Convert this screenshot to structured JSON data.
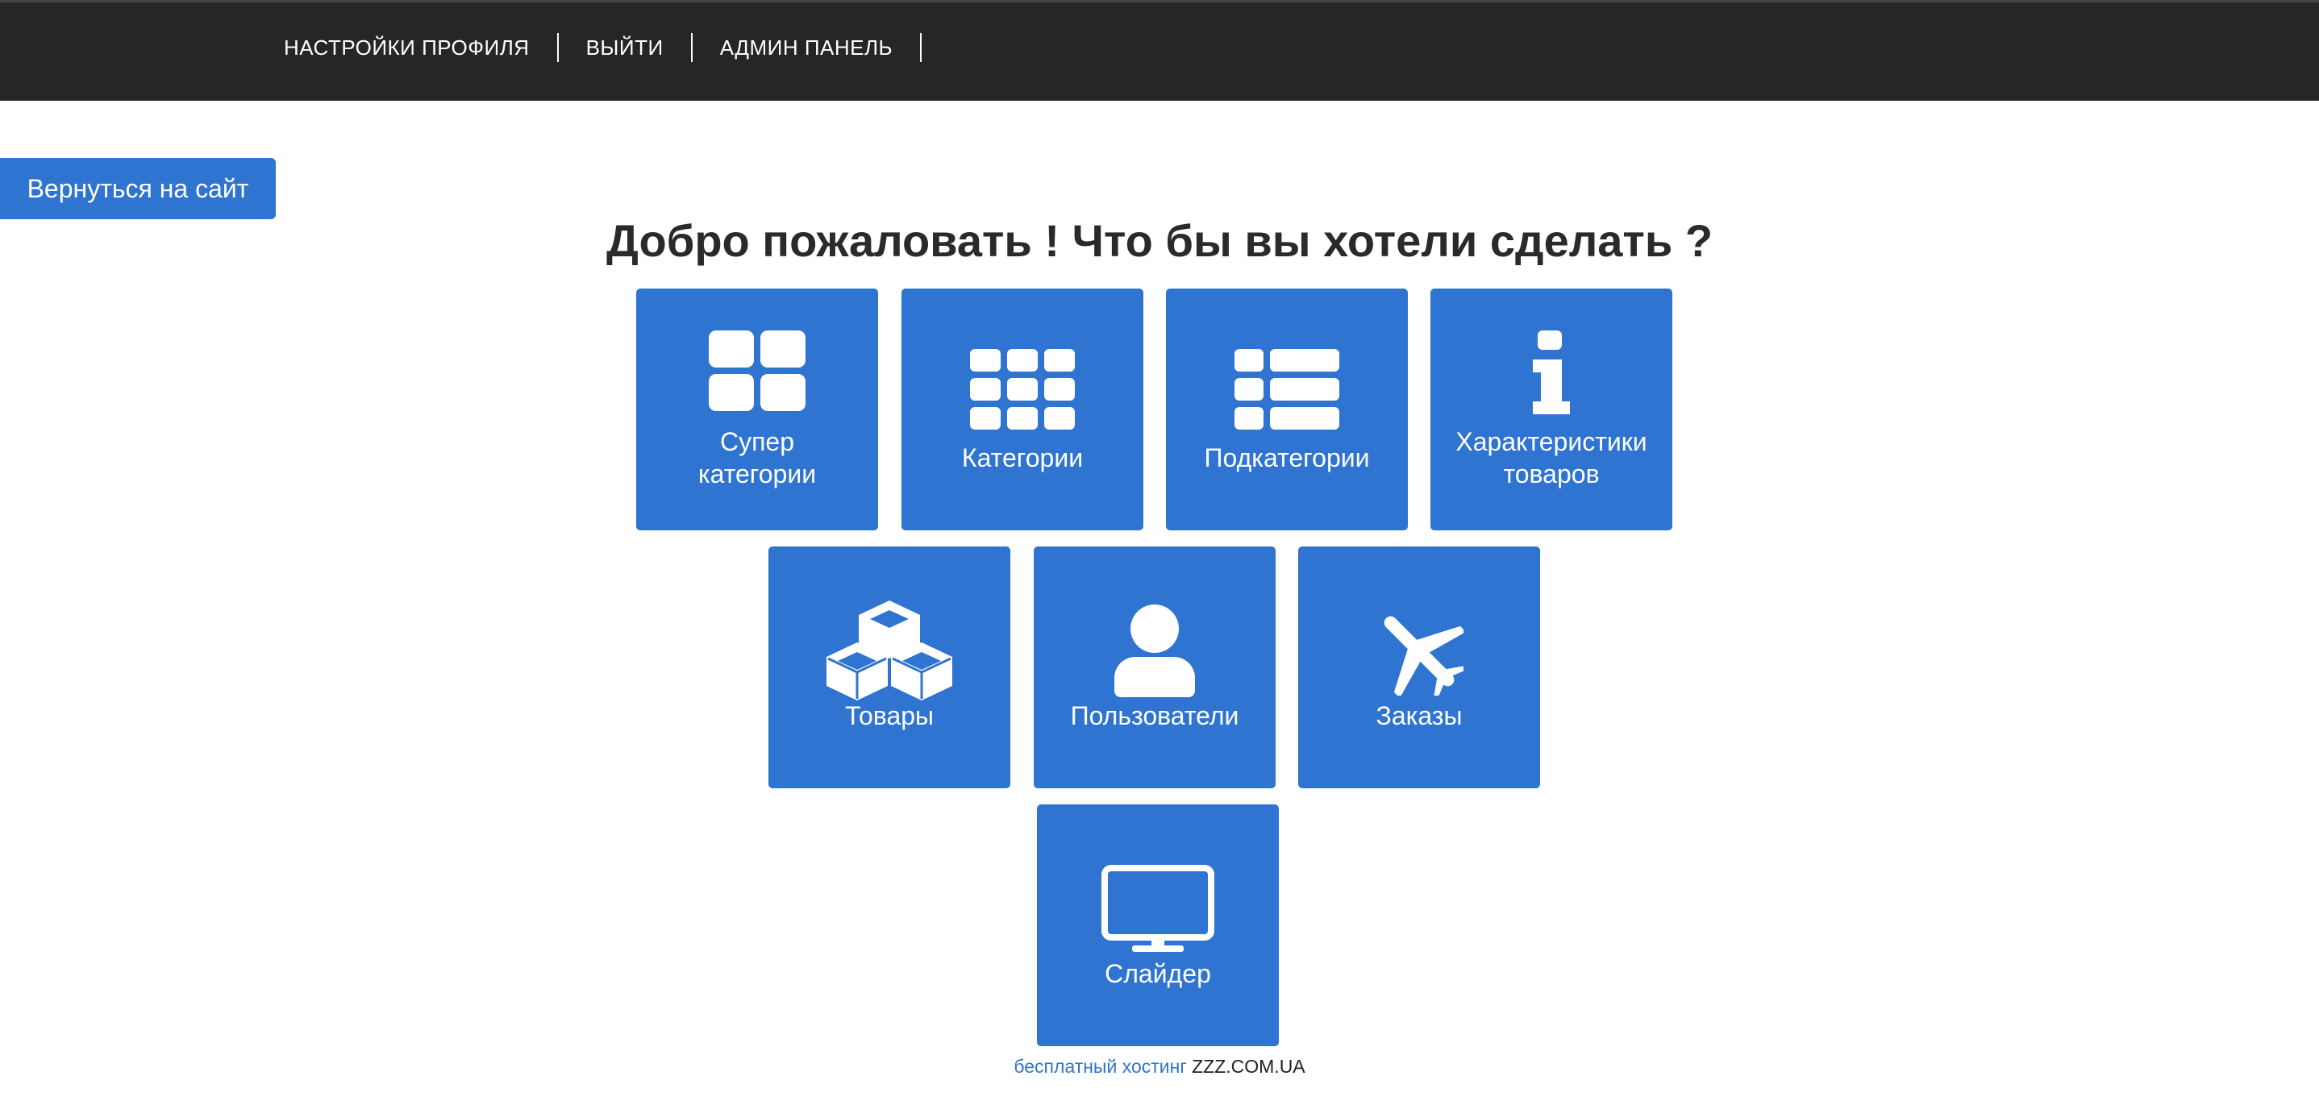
{
  "nav": {
    "items": [
      {
        "label": "НАСТРОЙКИ ПРОФИЛЯ"
      },
      {
        "label": "ВЫЙТИ"
      },
      {
        "label": "АДМИН ПАНЕЛЬ"
      }
    ]
  },
  "back_button": {
    "label": "Вернуться на сайт"
  },
  "heading": "Добро пожаловать ! Что бы вы хотели сделать ?",
  "tiles": [
    {
      "label_line1": "Супер",
      "label_line2": "категории",
      "icon": "th-large-icon"
    },
    {
      "label": "Категории",
      "icon": "th-icon"
    },
    {
      "label": "Подкатегории",
      "icon": "th-list-icon"
    },
    {
      "label_line1": "Характеристики",
      "label_line2": "товаров",
      "icon": "info-icon"
    },
    {
      "label": "Товары",
      "icon": "cubes-icon"
    },
    {
      "label": "Пользователи",
      "icon": "user-icon"
    },
    {
      "label": "Заказы",
      "icon": "plane-icon"
    },
    {
      "label": "Слайдер",
      "icon": "monitor-icon"
    }
  ],
  "footer": {
    "link_text": "бесплатный хостинг",
    "host_text": "ZZZ.COM.UA"
  },
  "colors": {
    "topbar": "#262626",
    "accent": "#2f74d0",
    "heading": "#2a2a2a"
  }
}
